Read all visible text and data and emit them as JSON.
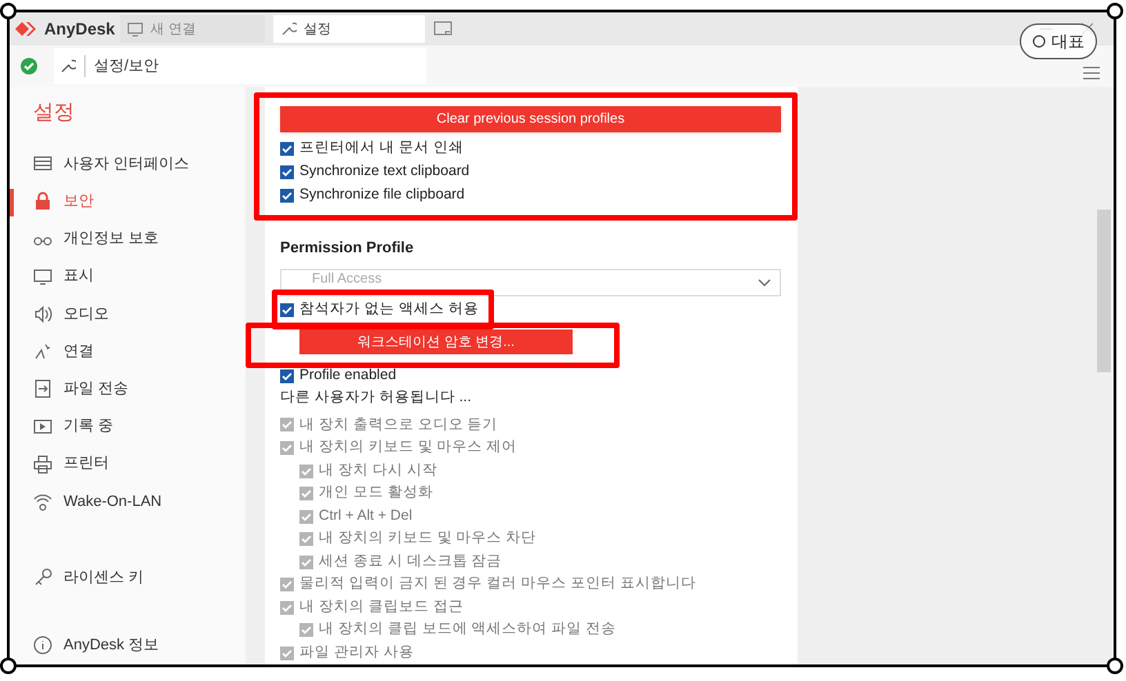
{
  "brand": {
    "name": "AnyDesk"
  },
  "tabs": [
    {
      "label": "새 연결",
      "selected": false
    },
    {
      "label": "설정",
      "selected": true
    }
  ],
  "address": "설정/보안",
  "badge": "대표",
  "sidebar": {
    "title": "설정",
    "items": [
      {
        "label": "사용자 인터페이스",
        "selected": false
      },
      {
        "label": "보안",
        "selected": true
      },
      {
        "label": "개인정보 보호",
        "selected": false
      },
      {
        "label": "표시",
        "selected": false
      },
      {
        "label": "오디오",
        "selected": false
      },
      {
        "label": "연결",
        "selected": false
      },
      {
        "label": "파일 전송",
        "selected": false
      },
      {
        "label": "기록 중",
        "selected": false
      },
      {
        "label": "프린터",
        "selected": false
      },
      {
        "label": "Wake-On-LAN",
        "selected": false
      }
    ],
    "footer": [
      {
        "label": "라이센스 키"
      },
      {
        "label": "AnyDesk 정보"
      }
    ]
  },
  "security": {
    "clear_button": "Clear previous session profiles",
    "clipboard_options": [
      {
        "label": "프린터에서 내 문서 인쇄",
        "checked": true
      },
      {
        "label": "Synchronize text clipboard",
        "checked": true
      },
      {
        "label": "Synchronize file clipboard",
        "checked": true
      }
    ],
    "permission_profile": {
      "title": "Permission Profile",
      "value": "Full Access"
    },
    "unattended": {
      "label": "참석자가 없는 액세스 허용",
      "checked": true
    },
    "password_button": "워크스테이션 암호 변경...",
    "profile_enabled": {
      "label": "Profile enabled",
      "checked": true
    },
    "allowed_heading": "다른 사용자가 허용됩니다 ...",
    "permissions": [
      {
        "label": "내 장치 출력으로 오디오 듣기",
        "checked": true,
        "disabled": true
      },
      {
        "label": "내 장치의 키보드 및 마우스 제어",
        "checked": true,
        "disabled": true,
        "children": [
          {
            "label": "내 장치 다시 시작",
            "checked": true,
            "disabled": true
          },
          {
            "label": "개인 모드 활성화",
            "checked": true,
            "disabled": true
          },
          {
            "label": "Ctrl + Alt + Del",
            "checked": true,
            "disabled": true
          },
          {
            "label": "내 장치의 키보드 및 마우스 차단",
            "checked": true,
            "disabled": true
          },
          {
            "label": "세션 종료 시 데스크톱 잠금",
            "checked": true,
            "disabled": true
          }
        ]
      },
      {
        "label": "물리적 입력이 금지 된 경우 컬러 마우스 포인터 표시합니다",
        "checked": true,
        "disabled": true
      },
      {
        "label": "내 장치의 클립보드 접근",
        "checked": true,
        "disabled": true,
        "children": [
          {
            "label": "내 장치의 클립 보드에 액세스하여 파일 전송",
            "checked": true,
            "disabled": true
          }
        ]
      },
      {
        "label": "파일 관리자 사용",
        "checked": true,
        "disabled": true
      }
    ]
  }
}
